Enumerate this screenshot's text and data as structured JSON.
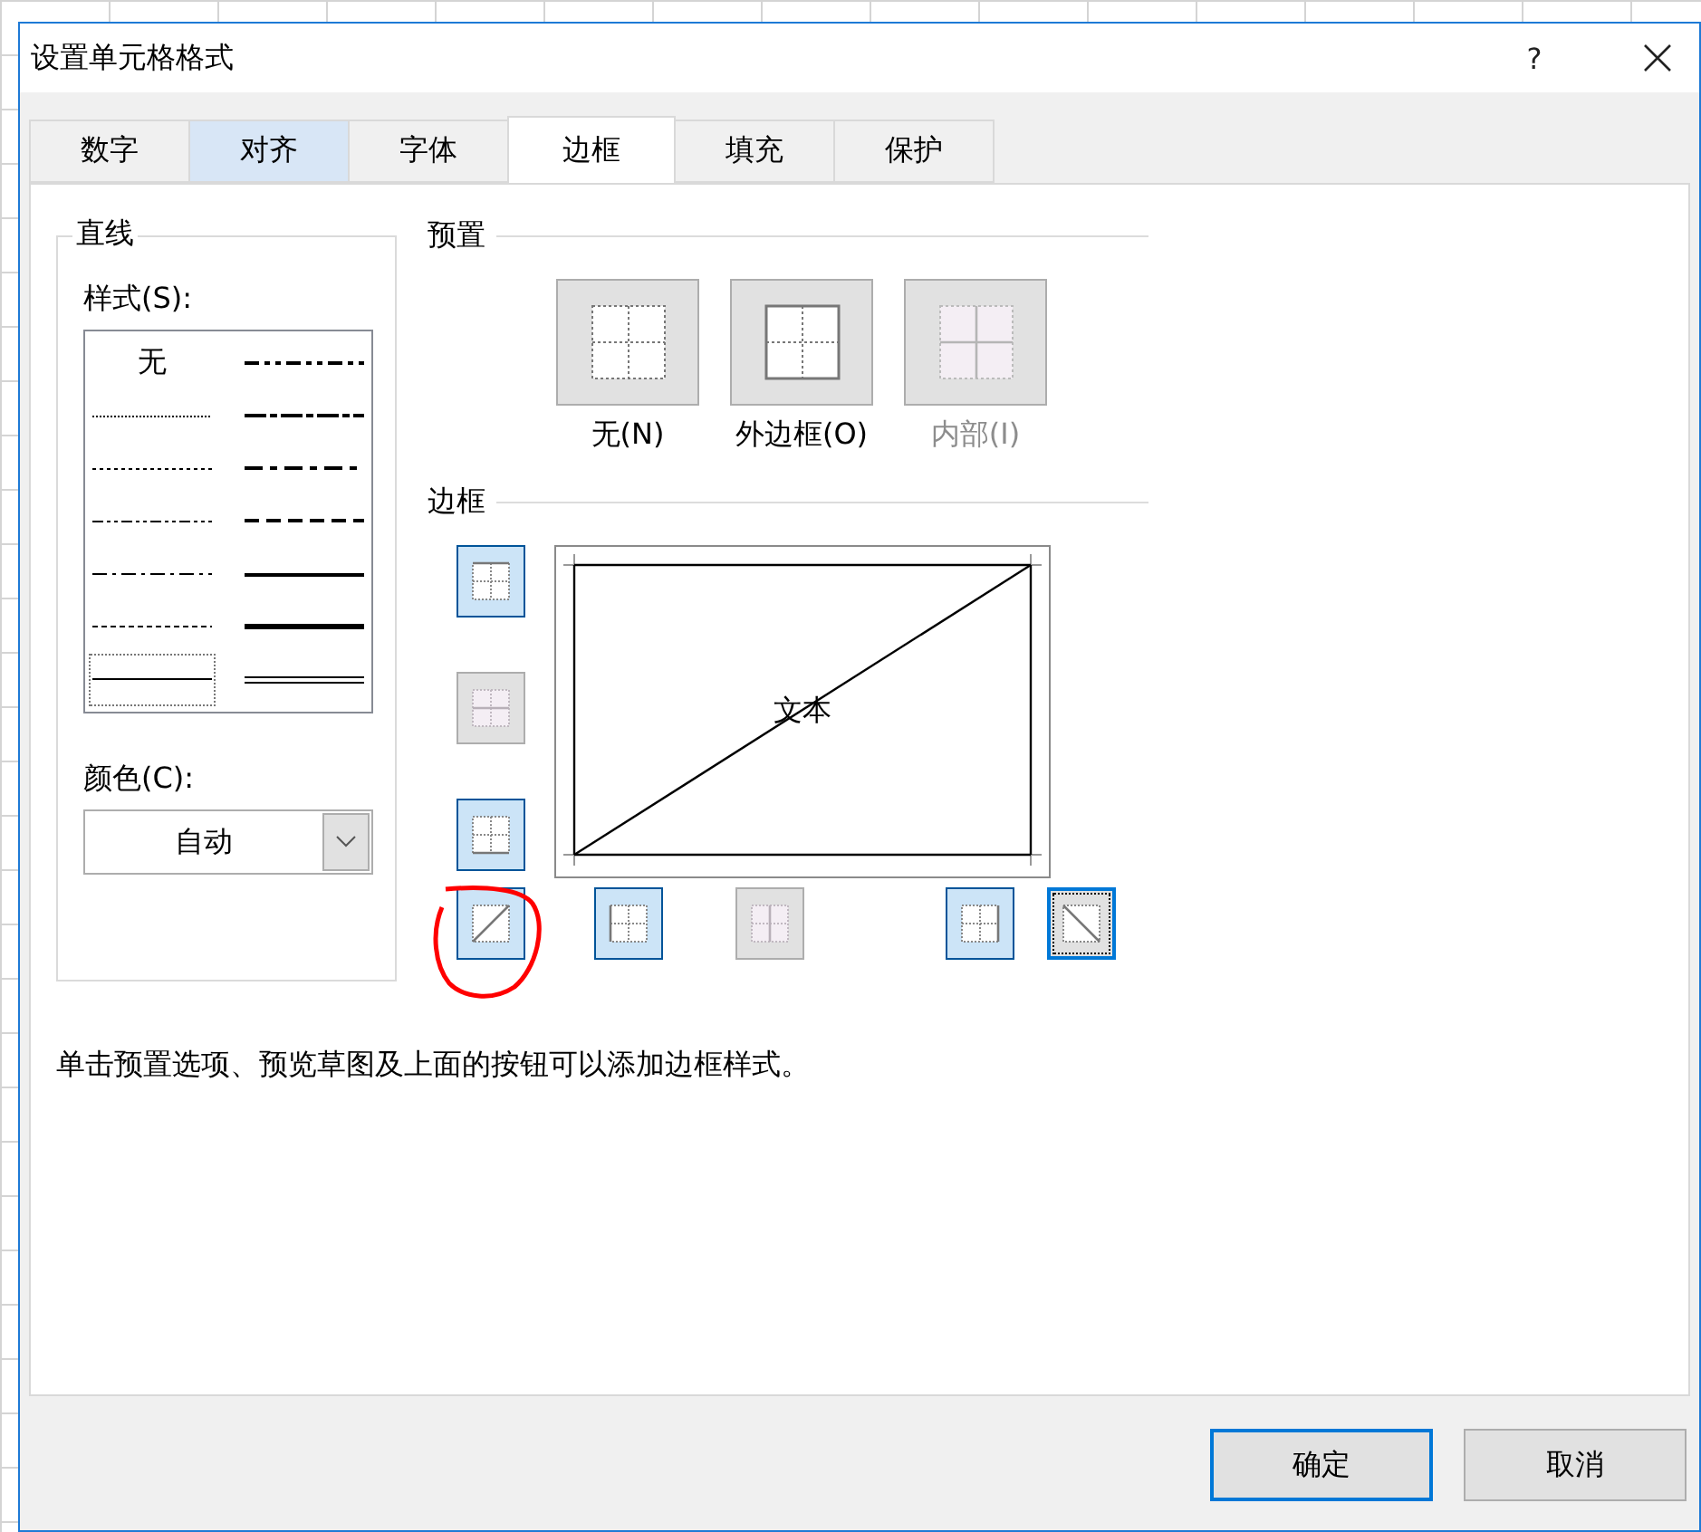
{
  "window": {
    "title": "设置单元格格式",
    "help": "?"
  },
  "tabs": [
    {
      "label": "数字",
      "selected": false,
      "hovered": false
    },
    {
      "label": "对齐",
      "selected": false,
      "hovered": true
    },
    {
      "label": "字体",
      "selected": false,
      "hovered": false
    },
    {
      "label": "边框",
      "selected": true,
      "hovered": false
    },
    {
      "label": "填充",
      "selected": false,
      "hovered": false
    },
    {
      "label": "保护",
      "selected": false,
      "hovered": false
    }
  ],
  "line_group": {
    "title": "直线",
    "style_label": "样式(S):",
    "color_label": "颜色(C):",
    "color_value": "自动"
  },
  "line_styles": [
    {
      "kind": "none",
      "label": "无",
      "selected": false
    },
    {
      "kind": "hair",
      "selected": false
    },
    {
      "kind": "dotted",
      "selected": false
    },
    {
      "kind": "dash_dot_dot",
      "selected": false
    },
    {
      "kind": "dash_dot",
      "selected": false
    },
    {
      "kind": "dashed",
      "selected": false
    },
    {
      "kind": "thin",
      "selected": true
    },
    {
      "kind": "medium_dash_dot_dot",
      "selected": false
    },
    {
      "kind": "slant_dash_dot",
      "selected": false
    },
    {
      "kind": "medium_dash_dot",
      "selected": false
    },
    {
      "kind": "medium_dashed",
      "selected": false
    },
    {
      "kind": "medium",
      "selected": false
    },
    {
      "kind": "thick",
      "selected": false
    },
    {
      "kind": "double",
      "selected": false
    }
  ],
  "presets": {
    "title": "预置",
    "items": [
      {
        "kind": "none",
        "label": "无(N)",
        "disabled": false
      },
      {
        "kind": "outline",
        "label": "外边框(O)",
        "disabled": false
      },
      {
        "kind": "inside",
        "label": "内部(I)",
        "disabled": true
      }
    ]
  },
  "border": {
    "title": "边框",
    "preview_text": "文本",
    "buttons": [
      {
        "kind": "top",
        "selected": true,
        "disabled": false,
        "focused": false
      },
      {
        "kind": "middle",
        "selected": false,
        "disabled": true,
        "focused": false
      },
      {
        "kind": "bottom",
        "selected": true,
        "disabled": false,
        "focused": false
      },
      {
        "kind": "diagonal_up",
        "selected": true,
        "disabled": false,
        "focused": false
      },
      {
        "kind": "left",
        "selected": true,
        "disabled": false,
        "focused": false
      },
      {
        "kind": "center",
        "selected": false,
        "disabled": true,
        "focused": false
      },
      {
        "kind": "right",
        "selected": true,
        "disabled": false,
        "focused": false
      },
      {
        "kind": "diagonal_down",
        "selected": false,
        "disabled": false,
        "focused": true
      }
    ]
  },
  "hint": "单击预置选项、预览草图及上面的按钮可以添加边框样式。",
  "buttons": [
    {
      "label": "确定",
      "default": true
    },
    {
      "label": "取消",
      "default": false
    }
  ]
}
